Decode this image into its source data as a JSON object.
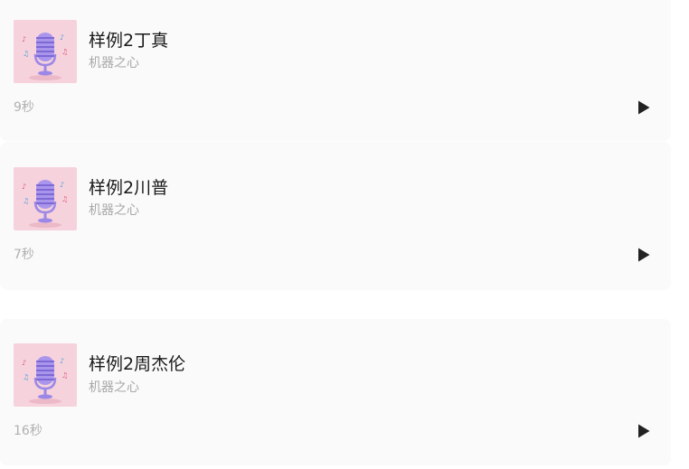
{
  "items": [
    {
      "title": "样例2丁真",
      "subtitle": "机器之心",
      "duration": "9秒",
      "icon": "microphone-icon",
      "action_icon": "play-icon"
    },
    {
      "title": "样例2川普",
      "subtitle": "机器之心",
      "duration": "7秒",
      "icon": "microphone-icon",
      "action_icon": "play-icon"
    },
    {
      "title": "样例2周杰伦",
      "subtitle": "机器之心",
      "duration": "16秒",
      "icon": "microphone-icon",
      "action_icon": "play-icon"
    }
  ],
  "colors": {
    "card_background": "#fafafa",
    "thumb_background": "#f6d2dc",
    "mic_body": "#a996ec",
    "play_icon": "#222222",
    "title_text": "#1a1a1a",
    "muted_text": "#a8a8a8"
  }
}
